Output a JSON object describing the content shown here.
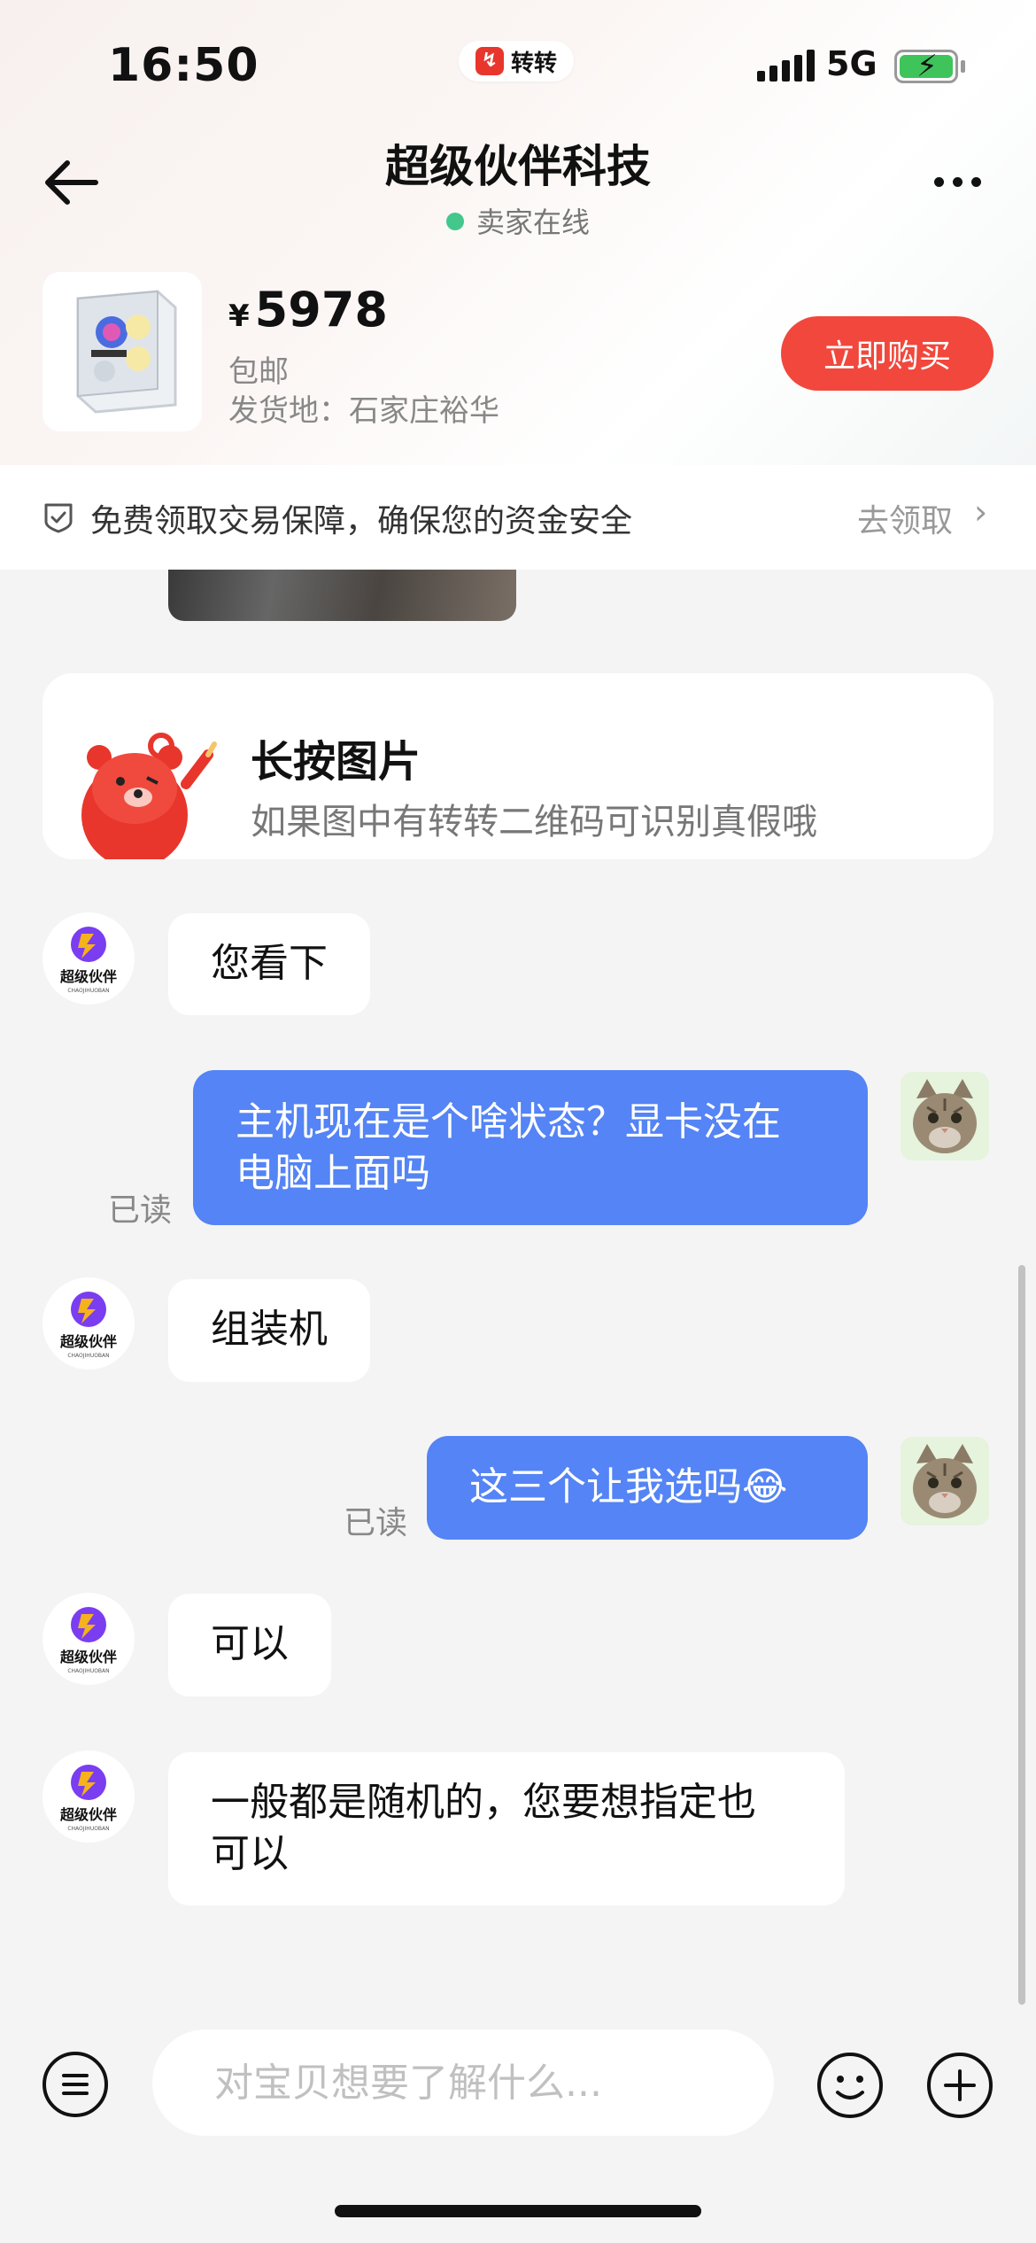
{
  "status_bar": {
    "time": "16:50",
    "app_name": "转转",
    "network": "5G"
  },
  "nav": {
    "title": "超级伙伴科技",
    "status": "卖家在线"
  },
  "product": {
    "currency": "¥",
    "price": "5978",
    "shipping": "包邮",
    "origin": "发货地：石家庄裕华",
    "buy_label": "立即购买"
  },
  "guarantee": {
    "text": "免费领取交易保障，确保您的资金安全",
    "link": "去领取"
  },
  "tip": {
    "title": "长按图片",
    "subtitle": "如果图中有转转二维码可识别真假哦"
  },
  "messages": [
    {
      "from": "seller",
      "text": "您看下"
    },
    {
      "from": "me",
      "line1": "主机现在是个啥状态？显卡没在",
      "line2": "电脑上面吗",
      "read": "已读"
    },
    {
      "from": "seller",
      "text": "组装机"
    },
    {
      "from": "me",
      "text": "这三个让我选吗",
      "emoji": "😂",
      "read": "已读"
    },
    {
      "from": "seller",
      "text": "可以"
    },
    {
      "from": "seller",
      "line1": "一般都是随机的，您要想指定也",
      "line2": "可以"
    }
  ],
  "seller_logo": {
    "name": "超级伙伴",
    "sub": "CHAOJIHUOBAN"
  },
  "input": {
    "placeholder": "对宝贝想要了解什么..."
  },
  "colors": {
    "accent_blue": "#5484f5",
    "buy_red": "#f2473c",
    "online_green": "#43c78b"
  }
}
